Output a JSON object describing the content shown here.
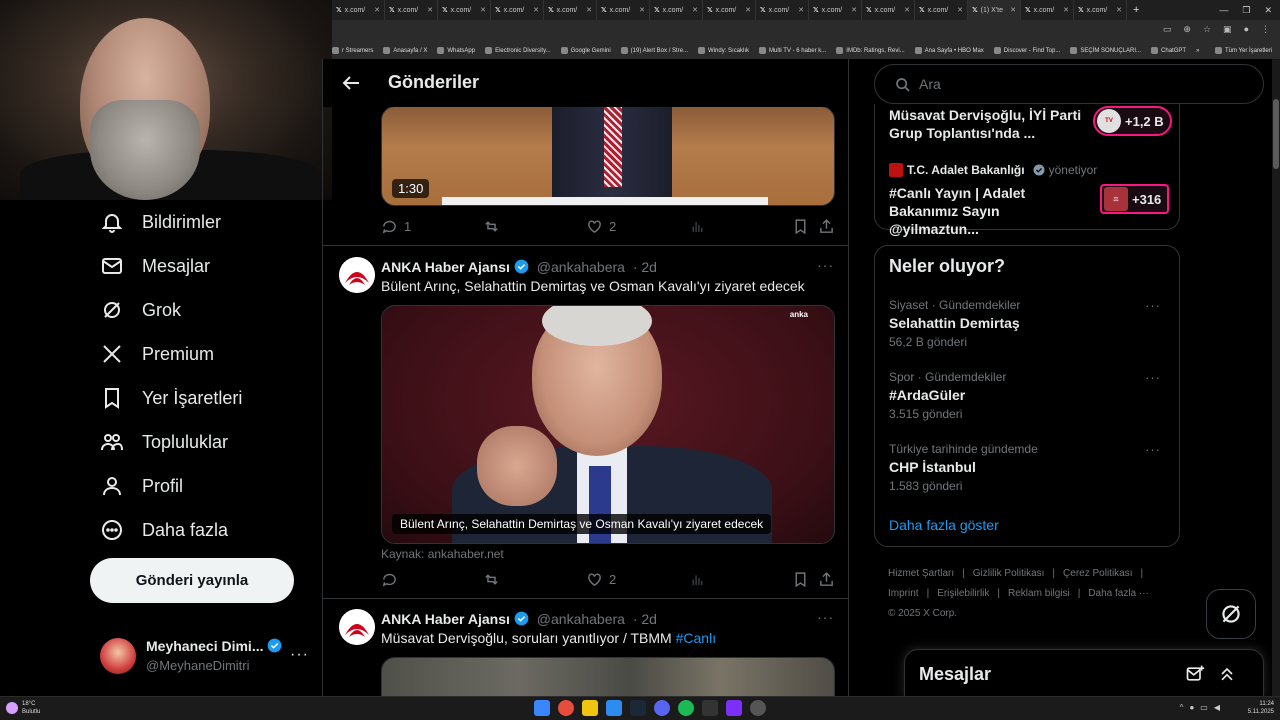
{
  "browser": {
    "tabs": [
      "x.com/",
      "x.com/",
      "x.com/",
      "x.com/",
      "x.com/",
      "x.com/",
      "x.com/",
      "x.com/",
      "x.com/",
      "x.com/",
      "x.com/",
      "x.com/",
      "(1) X'te",
      "x.com/",
      "x.com/"
    ],
    "new_tab": "+",
    "bookmarks": [
      "r Streamers",
      "Anasayfa / X",
      "WhatsApp",
      "Electronic Diversity...",
      "Google Gemini",
      "(19) Alert Box / Stre...",
      "Windy: Sıcaklık",
      "Multi TV - 6 haber k...",
      "IMDb: Ratings, Revi...",
      "Ana Sayfa • HBO Max",
      "Discover - Find Top...",
      "SEÇİM SONUÇLARI...",
      "ChatGPT",
      "»",
      "Tüm Yer İşaretleri"
    ]
  },
  "sidebar": {
    "items": [
      {
        "label": "Bildirimler",
        "icon": "bell-icon"
      },
      {
        "label": "Mesajlar",
        "icon": "envelope-icon"
      },
      {
        "label": "Grok",
        "icon": "grok-icon"
      },
      {
        "label": "Premium",
        "icon": "x-logo-icon"
      },
      {
        "label": "Yer İşaretleri",
        "icon": "bookmark-icon"
      },
      {
        "label": "Topluluklar",
        "icon": "people-icon"
      },
      {
        "label": "Profil",
        "icon": "person-icon"
      },
      {
        "label": "Daha fazla",
        "icon": "more-circle-icon"
      }
    ],
    "post_button": "Gönderi yayınla",
    "account": {
      "name": "Meyhaneci Dimi...",
      "handle": "@MeyhaneDimitri",
      "more": "···"
    }
  },
  "main": {
    "title": "Gönderiler",
    "tweet0": {
      "duration": "1:30",
      "replies": "1",
      "likes": "2"
    },
    "tweet1": {
      "name": "ANKA Haber Ajansı",
      "handle": "@ankahabera",
      "time": "· 2d",
      "text": "Bülent Arınç, Selahattin Demirtaş ve Osman Kavalı'yı ziyaret edecek",
      "media_caption": "Bülent Arınç, Selahattin Demirtaş ve Osman Kavalı'yı ziyaret edecek",
      "media_logo": "anka",
      "source": "Kaynak: ankahaber.net",
      "likes": "2"
    },
    "tweet2": {
      "name": "ANKA Haber Ajansı",
      "handle": "@ankahabera",
      "time": "· 2d",
      "text": "Müsavat Dervişoğlu, soruları yanıtlıyor / TBMM",
      "hashtag": "#Canlı"
    }
  },
  "right": {
    "search_placeholder": "Ara",
    "live1": {
      "title": "Müsavat Dervişoğlu, İYİ Parti Grup Toplantısı'nda ...",
      "count": "+1,2 B"
    },
    "live2": {
      "source": "T.C. Adalet Bakanlığı",
      "role": "yönetiyor",
      "title": "#Canlı Yayın | Adalet Bakanımız Sayın @yilmaztun...",
      "count": "+316"
    },
    "trends_title": "Neler oluyor?",
    "trends": [
      {
        "context": "Siyaset · Gündemdekiler",
        "name": "Selahattin Demirtaş",
        "count": "56,2 B gönderi"
      },
      {
        "context": "Spor · Gündemdekiler",
        "name": "#ArdaGüler",
        "count": "3.515 gönderi"
      },
      {
        "context": "Türkiye tarihinde gündemde",
        "name": "CHP İstanbul",
        "count": "1.583 gönderi"
      }
    ],
    "show_more": "Daha fazla göster",
    "footer": [
      "Hizmet Şartları",
      "|",
      "Gizlilik Politikası",
      "|",
      "Çerez Politikası",
      "|",
      "Imprint",
      "|",
      "Erişilebilirlik",
      "|",
      "Reklam bilgisi",
      "|",
      "Daha fazla ···",
      "© 2025 X Corp."
    ],
    "messages_title": "Mesajlar"
  },
  "taskbar": {
    "weather_temp": "18°C",
    "weather_desc": "Bulutlu",
    "time": "11:24",
    "date": "5.11.2025"
  },
  "colors": {
    "accent": "#1d9bf0",
    "live": "#f91880",
    "background": "#000000"
  }
}
